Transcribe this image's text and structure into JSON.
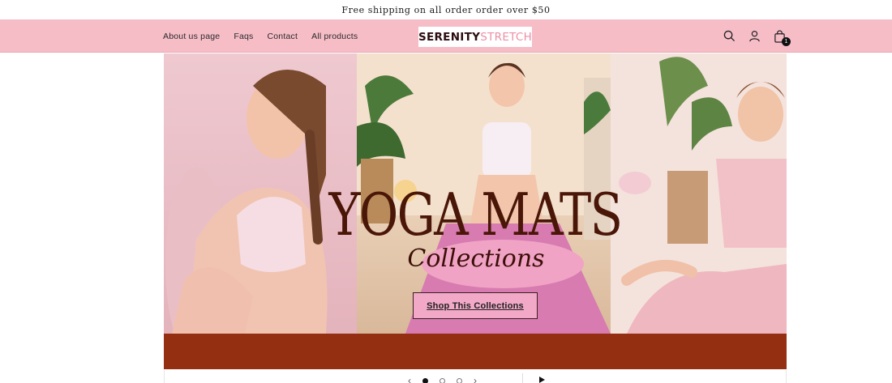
{
  "announcement": {
    "text": "Free shipping on all order order over $50"
  },
  "nav": {
    "items": [
      "About us page",
      "Faqs",
      "Contact",
      "All products"
    ]
  },
  "logo": {
    "part1": "SERENITY",
    "part2": "STRETCH"
  },
  "header_icons": {
    "search": "search-icon",
    "account": "account-icon",
    "cart": "cart-icon",
    "cart_count": "1"
  },
  "hero": {
    "title": "YOGA MATS",
    "subtitle": "Collections",
    "cta_label": "Shop This Collections"
  },
  "slider": {
    "prev": "‹",
    "next": "›",
    "slides": 3,
    "active": 1
  },
  "colors": {
    "header_bg": "#f6bdc7",
    "band": "#952f12",
    "title": "#4a1608",
    "cta_bg": "#f2a9c7"
  }
}
